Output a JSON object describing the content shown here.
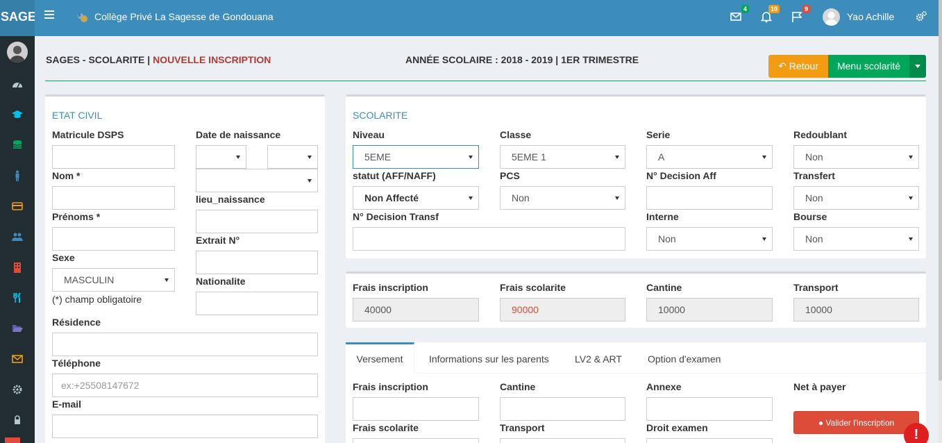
{
  "app": {
    "logo": "SAGE",
    "school": "Collège Privé La Sagesse de Gondouana",
    "user": "Yao Achille"
  },
  "notifications": {
    "messages": "4",
    "alerts": "10",
    "flags": "9"
  },
  "colors": {
    "topbar": "#3c8dbc",
    "sidebar": "#222d32",
    "accent": "#3c8dbc",
    "warning": "#f39c12",
    "success": "#00a65a",
    "danger": "#dd4b39"
  },
  "sidebar_icons": [
    "dashboard-icon",
    "graduation-cap-icon",
    "database-icon",
    "male-icon",
    "credit-card-icon",
    "users-icon",
    "building-icon",
    "cutlery-icon",
    "folder-open-icon",
    "envelope-icon",
    "gear-icon",
    "lock-icon"
  ],
  "header": {
    "crumb_main": "SAGES - SCOLARITE",
    "crumb_sep": " | ",
    "crumb_page": "NOUVELLE INSCRIPTION",
    "year": "ANNÉE SCOLAIRE : 2018 - 2019 | 1ER TRIMESTRE",
    "retour": "Retour",
    "menu": "Menu scolarité"
  },
  "etat_civil": {
    "title": "ETAT CIVIL",
    "matricule": {
      "label": "Matricule DSPS",
      "value": ""
    },
    "nom": {
      "label": "Nom *",
      "value": ""
    },
    "prenoms": {
      "label": "Prénoms *",
      "value": ""
    },
    "sexe": {
      "label": "Sexe",
      "value": "MASCULIN"
    },
    "obligatoire": "(*) champ obligatoire",
    "date_naissance": {
      "label": "Date de naissance",
      "day": "",
      "month": "",
      "year": ""
    },
    "lieu": {
      "label": "lieu_naissance",
      "value": ""
    },
    "extrait": {
      "label": "Extrait N°",
      "value": ""
    },
    "nationalite": {
      "label": "Nationalite",
      "value": ""
    },
    "residence": {
      "label": "Résidence",
      "value": ""
    },
    "telephone": {
      "label": "Téléphone",
      "placeholder": "ex:+25508147672"
    },
    "email": {
      "label": "E-mail",
      "value": ""
    }
  },
  "scolarite": {
    "title": "SCOLARITE",
    "niveau": {
      "label": "Niveau",
      "value": "5EME"
    },
    "classe": {
      "label": "Classe",
      "value": "5EME 1"
    },
    "serie": {
      "label": "Serie",
      "value": "A"
    },
    "redoublant": {
      "label": "Redoublant",
      "value": "Non"
    },
    "statut": {
      "label": "statut (AFF/NAFF)",
      "value": "Non Affecté"
    },
    "pcs": {
      "label": "PCS",
      "value": "Non"
    },
    "decision_aff": {
      "label": "N° Decision Aff",
      "value": ""
    },
    "transfert": {
      "label": "Transfert",
      "value": "Non"
    },
    "decision_transf": {
      "label": "N° Decision Transf",
      "value": ""
    },
    "interne": {
      "label": "Interne",
      "value": "Non"
    },
    "bourse": {
      "label": "Bourse",
      "value": "Non"
    }
  },
  "frais": {
    "inscription": {
      "label": "Frais inscription",
      "value": "40000"
    },
    "scolarite": {
      "label": "Frais scolarite",
      "value": "90000"
    },
    "cantine": {
      "label": "Cantine",
      "value": "10000"
    },
    "transport": {
      "label": "Transport",
      "value": "10000"
    }
  },
  "tabs": [
    "Versement",
    "Informations sur les parents",
    "LV2 & ART",
    "Option d'examen"
  ],
  "versement": {
    "frais_inscription": "Frais inscription",
    "cantine": "Cantine",
    "annexe": "Annexe",
    "net": "Net à payer",
    "frais_scolarite": "Frais scolarite",
    "transport": "Transport",
    "droit_examen": "Droit examen",
    "valider": "Valider l'inscription"
  },
  "alert_badge": "!"
}
